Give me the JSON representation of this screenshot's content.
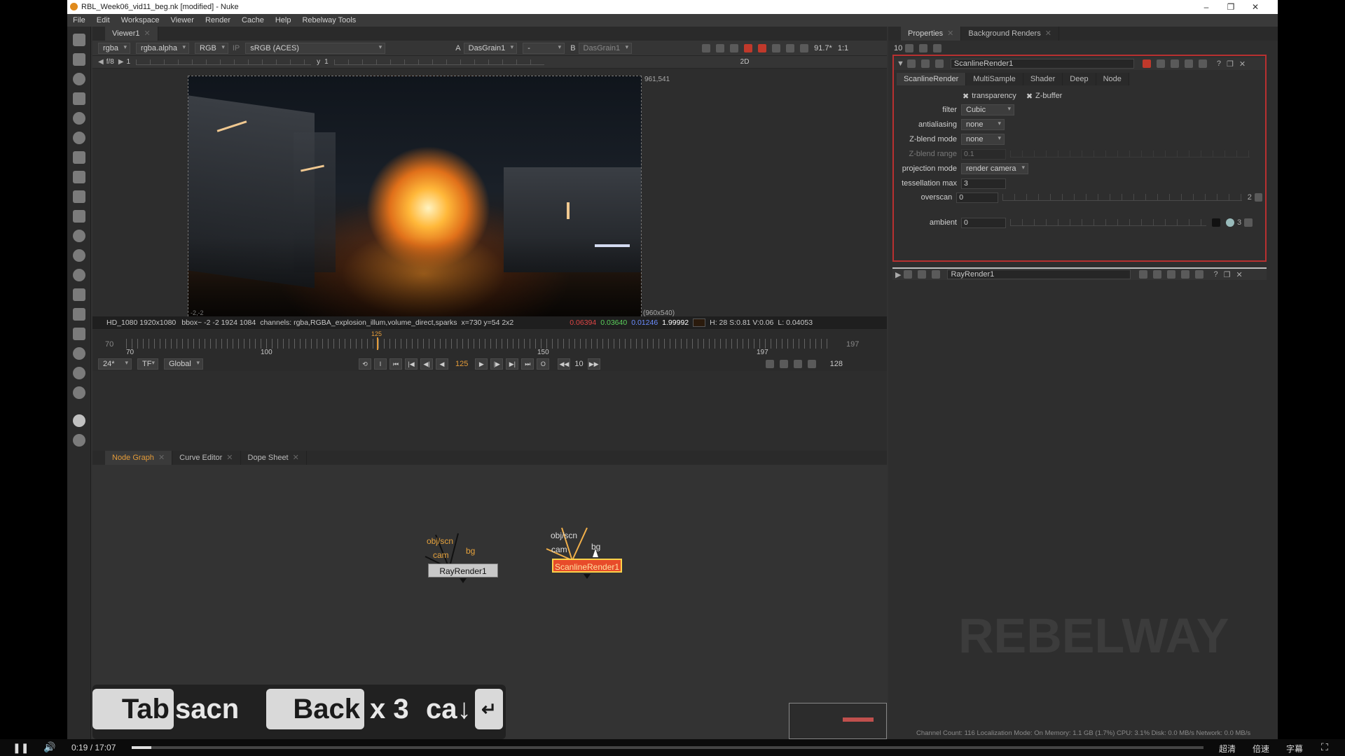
{
  "window": {
    "title": "RBL_Week06_vid11_beg.nk [modified] - Nuke"
  },
  "menu": [
    "File",
    "Edit",
    "Workspace",
    "Viewer",
    "Render",
    "Cache",
    "Help",
    "Rebelway Tools"
  ],
  "viewer": {
    "tab": "Viewer1",
    "channels": "rgba",
    "alpha": "rgba.alpha",
    "mode": "RGB",
    "ip": "IP",
    "colorspace": "sRGB (ACES)",
    "input_a_label": "A",
    "input_a": "DasGrain1",
    "input_a_op": "-",
    "input_b_label": "B",
    "input_b": "DasGrain1",
    "zoom": "91.7*",
    "ratio": "1:1",
    "view_mode": "2D",
    "fstop": "f/8",
    "frame_field": "1",
    "y_label": "y",
    "y_field": "1",
    "coord_top_right": "961,541",
    "coord_bottom_right": "(960x540)",
    "coord_bottom_left": "-2,-2",
    "info": {
      "format": "HD_1080 1920x1080",
      "bbox": "bbox~ -2 -2 1924 1084",
      "channels": "channels: rgba,RGBA_explosion_illum,volume_direct,sparks",
      "pos": "x=730 y=54 2x2",
      "r": "0.06394",
      "g": "0.03640",
      "b": "0.01246",
      "a": "1.99992",
      "hsv": "H: 28 S:0.81 V:0.06",
      "lum": "L: 0.04053"
    }
  },
  "timeline": {
    "start": "70",
    "end": "197",
    "ticks": [
      "70",
      "100",
      "150",
      "197"
    ],
    "marker": "125",
    "current": "125",
    "fps": "24*",
    "tf": "TF",
    "range": "Global",
    "step": "10",
    "end_field": "128",
    "out_icon": "O",
    "in_icon": "I"
  },
  "nodegraph": {
    "tabs": [
      "Node Graph",
      "Curve Editor",
      "Dope Sheet"
    ],
    "nodes": [
      {
        "name": "RayRender1",
        "inputs": [
          "obj/scn",
          "cam",
          "bg"
        ]
      },
      {
        "name": "ScanlineRender1",
        "inputs": [
          "obj/scn",
          "cam",
          "bg"
        ]
      }
    ]
  },
  "properties": {
    "tabs": [
      "Properties",
      "Background Renders"
    ],
    "max_panels": "10",
    "node1": "ScanlineRender1",
    "node2": "RayRender1",
    "subtabs": [
      "ScanlineRender",
      "MultiSample",
      "Shader",
      "Deep",
      "Node"
    ],
    "checks": [
      "transparency",
      "Z-buffer"
    ],
    "fields": [
      {
        "label": "filter",
        "value": "Cubic",
        "type": "dropdown"
      },
      {
        "label": "antialiasing",
        "value": "none",
        "type": "dropdown"
      },
      {
        "label": "Z-blend mode",
        "value": "none",
        "type": "dropdown"
      },
      {
        "label": "Z-blend range",
        "value": "0.1",
        "type": "slider"
      },
      {
        "label": "projection mode",
        "value": "render camera",
        "type": "dropdown"
      },
      {
        "label": "tessellation max",
        "value": "3",
        "type": "field"
      },
      {
        "label": "overscan",
        "value": "0",
        "type": "slider"
      },
      {
        "label": "ambient",
        "value": "0",
        "type": "slider"
      }
    ],
    "overscan_extra": "2",
    "ambient_extra": "3"
  },
  "keys": [
    "Tab",
    "sacn",
    "Back",
    "x 3",
    "ca↓",
    "↵"
  ],
  "status": "Channel Count: 116  Localization Mode: On  Memory: 1.1 GB (1.7%)  CPU: 3.1%  Disk: 0.0 MB/s  Network: 0.0 MB/s",
  "player": {
    "time": "0:19 / 17:07",
    "quality": "超清",
    "speed": "倍速",
    "subtitle": "字幕",
    "progress": 0.0185
  },
  "colors": {
    "accent": "#e39b39",
    "node_selected": "#e84b2a",
    "panel_outline": "#b83030"
  }
}
